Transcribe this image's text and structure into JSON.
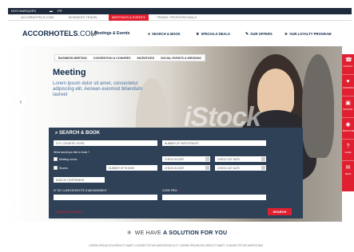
{
  "topbar": {
    "region": "NOS MARQUES",
    "lang": "FR"
  },
  "tabs": [
    {
      "label": "ACCORHOTELS.COM"
    },
    {
      "label": "BUSINESS TRAVEL"
    },
    {
      "label": "MEETINGS & EVENTS",
      "active": true
    },
    {
      "label": "TRAVEL PROFESSIONALS"
    }
  ],
  "header": {
    "logo_main": "ACCORHOTELS",
    "logo_com": ".COM",
    "logo_sub": "Meetings & Events",
    "nav": [
      {
        "label": "SEARCH & BOOK",
        "icon": "pin-icon"
      },
      {
        "label": "SPECIALS DEALS",
        "icon": "star-icon"
      },
      {
        "label": "OUR OFFERS",
        "icon": "tag-icon"
      },
      {
        "label": "OUR LOYALTY PROGRAM",
        "icon": "plane-icon"
      }
    ]
  },
  "hero": {
    "subnav": [
      "BUSINESS MEETING",
      "CONVENTION & CONGRES",
      "INCENTIVES",
      "SOCIAL EVENTS & WEDDING"
    ],
    "title": "Meeting",
    "text": "Lorem ipsum dolor sit amet, consectetur adipiscing elit. Aenean euismod bibendum laoreet",
    "watermark": "iStock"
  },
  "sidemenu": [
    {
      "label": "CONTACT",
      "icon": "phone-icon"
    },
    {
      "label": "FAVORITES",
      "icon": "heart-icon"
    },
    {
      "label": "BOOKING",
      "icon": "briefcase-icon"
    },
    {
      "label": "BROCHURE",
      "icon": "info-icon"
    },
    {
      "label": "GUIDE",
      "icon": "question-icon"
    },
    {
      "label": "NEWS",
      "icon": "mail-icon"
    }
  ],
  "search": {
    "title": "SEARCH & BOOK",
    "city_placeholder": "CITY, COUNTRY, HOTEL",
    "participants_placeholder": "NUMBER OF PARTICIPANTS",
    "what_need": "What would you like to book ?",
    "meeting_rooms": "Meeting rooms",
    "rooms": "Rooms",
    "num_rooms_placeholder": "NUMBER OF ROOMS",
    "checkin": "CHECK-IN DATE",
    "checkout": "CHECK-OUT DATE",
    "event_type": "NOM DE L'ÉVÉNEMENT",
    "code_label": "N° DE CLIENT/IDENTITÉ D'ABONNEMENT",
    "promo_label": "CODE PRIX",
    "link": "ADVANCED SEARCH",
    "button": "SEARCH"
  },
  "solution": {
    "pre": "WE HAVE",
    "bold": "A SOLUTION FOR YOU"
  },
  "lorem": "LOREM IPSUM DOLORES ET AMET, CONSECTETUR ADIPISCING ELIT. LOREM IPSUM DOLORES ET AMET, CONSECTETUR ADIPISCING",
  "colors": {
    "accent": "#e02030",
    "navy": "#0f2a4a",
    "panel": "#2f4156"
  }
}
